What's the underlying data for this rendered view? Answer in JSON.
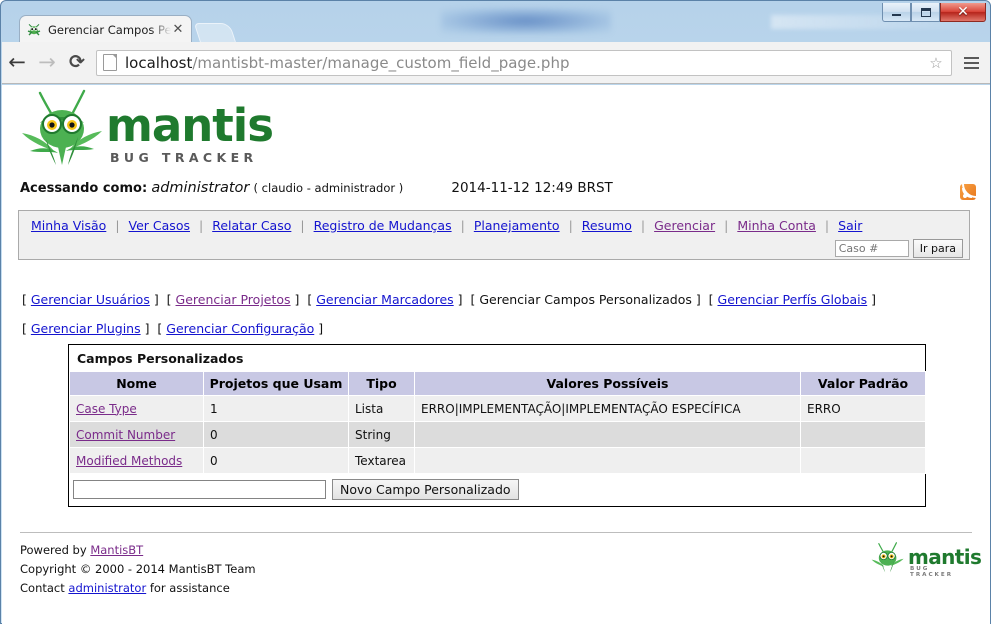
{
  "window": {
    "minimize_label": "Minimize",
    "maximize_label": "Maximize",
    "close_label": "✕"
  },
  "browser": {
    "tab": {
      "title": "Gerenciar Campos Person",
      "favicon": "mantis-favicon",
      "close_label": "✕"
    },
    "new_tab_label": "",
    "back_label": "←",
    "forward_label": "→",
    "reload_label": "⟳",
    "url_host": "localhost",
    "url_path": "/mantisbt-master/manage_custom_field_page.php",
    "star_label": "☆",
    "menu_label": "≡"
  },
  "header": {
    "logo_word": "mantis",
    "logo_sub": "BUG TRACKER",
    "access_label": "Acessando como:",
    "username": "administrator",
    "user_detail": "( claudio - administrador )",
    "timestamp": "2014-11-12 12:49 BRST"
  },
  "mainnav": {
    "items": [
      {
        "label": "Minha Visão",
        "visited": false
      },
      {
        "label": "Ver Casos",
        "visited": false
      },
      {
        "label": "Relatar Caso",
        "visited": false
      },
      {
        "label": "Registro de Mudanças",
        "visited": false
      },
      {
        "label": "Planejamento",
        "visited": false
      },
      {
        "label": "Resumo",
        "visited": false
      },
      {
        "label": "Gerenciar",
        "visited": true
      },
      {
        "label": "Minha Conta",
        "visited": true
      },
      {
        "label": "Sair",
        "visited": false
      }
    ],
    "separator": "|",
    "case_placeholder": "Caso #",
    "case_value": "",
    "goto_label": "Ir para"
  },
  "subnav": {
    "open_bracket": "[",
    "close_bracket": "]",
    "row1": [
      {
        "label": "Gerenciar Usuários",
        "type": "link",
        "visited": false
      },
      {
        "label": "Gerenciar Projetos",
        "type": "link",
        "visited": true
      },
      {
        "label": "Gerenciar Marcadores",
        "type": "link",
        "visited": false
      },
      {
        "label": "Gerenciar Campos Personalizados",
        "type": "current",
        "visited": false
      },
      {
        "label": "Gerenciar Perfís Globais",
        "type": "link",
        "visited": false
      }
    ],
    "row2": [
      {
        "label": "Gerenciar Plugins",
        "type": "link",
        "visited": false
      },
      {
        "label": "Gerenciar Configuração",
        "type": "link",
        "visited": false
      }
    ]
  },
  "table": {
    "caption": "Campos Personalizados",
    "columns": [
      "Nome",
      "Projetos que Usam",
      "Tipo",
      "Valores Possíveis",
      "Valor Padrão"
    ],
    "rows": [
      {
        "name": "Case Type",
        "projects": "1",
        "type": "Lista",
        "possible_values": "ERRO|IMPLEMENTAÇÃO|IMPLEMENTAÇÃO ESPECÍFICA",
        "default_value": "ERRO"
      },
      {
        "name": "Commit Number",
        "projects": "0",
        "type": "String",
        "possible_values": "",
        "default_value": ""
      },
      {
        "name": "Modified Methods",
        "projects": "0",
        "type": "Textarea",
        "possible_values": "",
        "default_value": ""
      }
    ],
    "new_field_value": "",
    "new_field_button": "Novo Campo Personalizado"
  },
  "footer": {
    "powered_prefix": "Powered by ",
    "powered_link": "MantisBT",
    "copyright": "Copyright © 2000 - 2014 MantisBT Team",
    "contact_prefix": "Contact ",
    "contact_link": "administrator",
    "contact_suffix": " for assistance",
    "logo_word": "mantis",
    "logo_sub": "BUG TRACKER"
  },
  "colors": {
    "link": "#1414cf",
    "visited_link": "#7a2b8a",
    "table_header_bg": "#c8c8e4",
    "row_odd_bg": "#efefef",
    "row_even_bg": "#dcdcdc",
    "mantis_green": "#1f7a2e",
    "rss_orange": "#e8761a"
  }
}
